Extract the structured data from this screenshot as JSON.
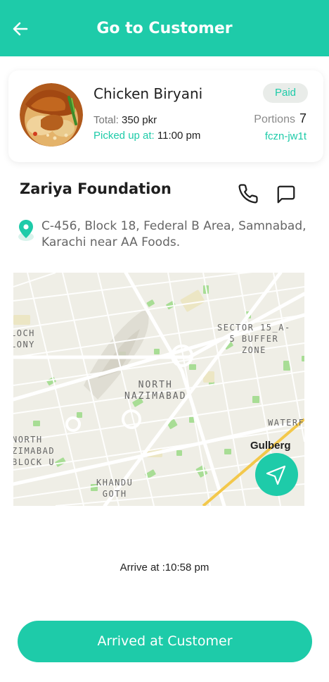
{
  "header": {
    "title": "Go to Customer",
    "back_icon": "arrow-left-icon"
  },
  "order": {
    "food_name": "Chicken Biryani",
    "total_label": "Total:",
    "total_value": "350 pkr",
    "picked_label": "Picked up at:",
    "picked_value": "11:00 pm",
    "payment_status": "Paid",
    "portions_label": "Portions",
    "portions_value": "7",
    "order_code": "fczn-jw1t"
  },
  "customer": {
    "name": "Zariya Foundation",
    "address": "C-456, Block 18, Federal B Area, Samnabad, Karachi near AA Foods.",
    "phone_icon": "phone-icon",
    "chat_icon": "chat-icon",
    "location_icon": "location-pin-icon"
  },
  "map": {
    "labels": {
      "loch_colony": "LOCH\nLONY",
      "sector": "SECTOR 15_A-\n5 BUFFER\nZONE",
      "north_nazimabad": "NORTH\nNAZIMABAD",
      "waterp": "WATERF",
      "gulberg": "Gulberg",
      "block_u": "NORTH\nZIMABAD\nBLOCK U",
      "khandu": "KHANDU\nGOTH"
    },
    "nav_icon": "navigation-arrow-icon"
  },
  "arrival": {
    "text": "Arrive at :10:58 pm"
  },
  "actions": {
    "arrived_label": "Arrived at Customer"
  },
  "colors": {
    "accent": "#1ecba9",
    "badge_bg": "#e9ece9",
    "map_bg": "#efeee6",
    "map_park": "#a8dd95",
    "map_highway": "#f3c84b"
  }
}
